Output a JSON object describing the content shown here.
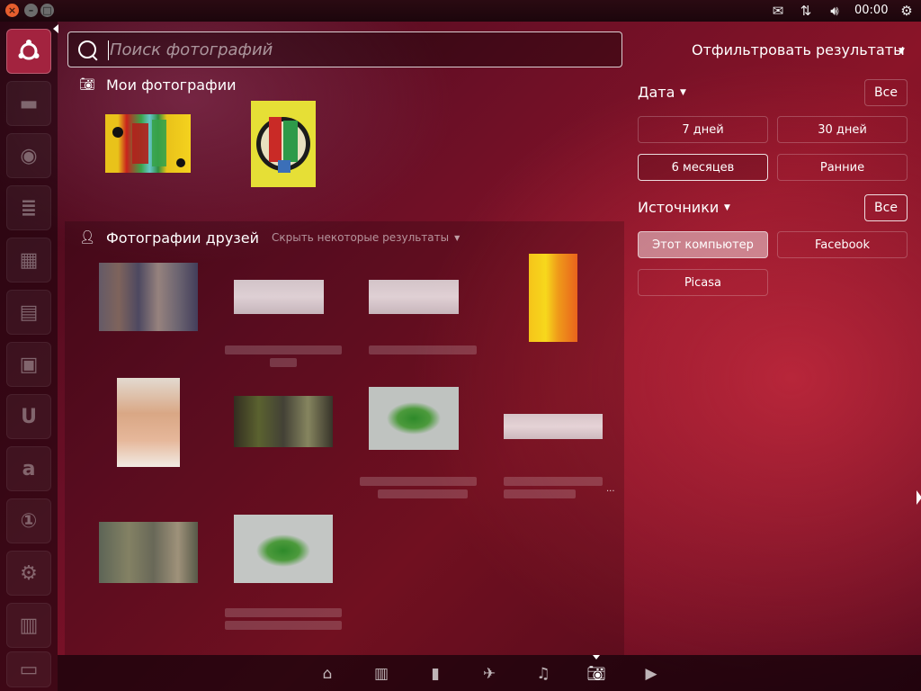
{
  "panel": {
    "clock": "00:00",
    "icons": [
      "mail-icon",
      "network-icon",
      "volume-icon",
      "power-icon"
    ]
  },
  "launcher": {
    "items": [
      "ubuntu-home",
      "files",
      "firefox",
      "writer",
      "calc",
      "impress",
      "software-center",
      "ubuntu-one",
      "amazon",
      "ubuntu-one-music",
      "system-settings",
      "workspaces",
      "trash"
    ]
  },
  "search": {
    "placeholder": "Поиск фотографий",
    "value": ""
  },
  "sections": {
    "my_photos": {
      "title": "Мои фотографии"
    },
    "friends_photos": {
      "title": "Фотографии друзей",
      "hide_results": "Скрыть некоторые результаты"
    }
  },
  "filters": {
    "title": "Отфильтровать результаты",
    "date": {
      "label": "Дата",
      "all": "Все",
      "options": [
        "7 дней",
        "30 дней",
        "6 месяцев",
        "Ранние"
      ],
      "active": "6 месяцев"
    },
    "sources": {
      "label": "Источники",
      "all": "Все",
      "options": [
        "Этот компьютер",
        "Facebook",
        "Picasa"
      ],
      "selected": "Этот компьютер"
    }
  },
  "more_indicator": "...",
  "lenses": [
    "home-lens",
    "applications-lens",
    "files-lens",
    "social-lens",
    "music-lens",
    "photos-lens",
    "video-lens"
  ],
  "active_lens": "photos-lens",
  "colors": {
    "accent": "#a3233f",
    "background": "#6b0f26"
  }
}
